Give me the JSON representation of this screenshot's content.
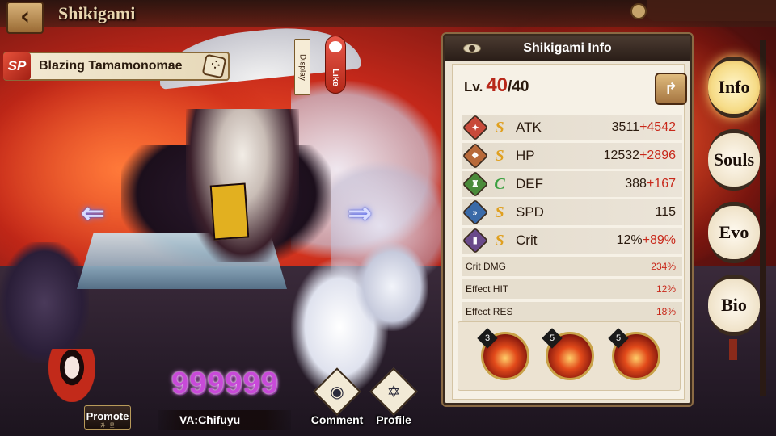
{
  "header": {
    "title": "Shikigami",
    "back_icon": "back-arrow-icon"
  },
  "character": {
    "rarity": "SP",
    "name": "Blazing Tamamonomae",
    "display_label": "Display",
    "like_label": "Like"
  },
  "bottom": {
    "promote_label": "Promote",
    "promote_sub": "升 · 星",
    "coins": "999999",
    "va": "VA:Chifuyu",
    "comment_label": "Comment",
    "profile_label": "Profile"
  },
  "info_panel": {
    "title": "Shikigami Info",
    "level_label": "Lv.",
    "level_current": "40",
    "level_max": "/40",
    "stats": [
      {
        "name": "ATK",
        "grade": "S",
        "base": "3511",
        "bonus": "+4542",
        "icon": "atk-icon",
        "color": "#c84a3a"
      },
      {
        "name": "HP",
        "grade": "S",
        "base": "12532",
        "bonus": "+2896",
        "icon": "hp-icon",
        "color": "#b86a3a"
      },
      {
        "name": "DEF",
        "grade": "C",
        "base": "388",
        "bonus": "+167",
        "icon": "def-icon",
        "color": "#4a8a3a"
      },
      {
        "name": "SPD",
        "grade": "S",
        "base": "115",
        "bonus": "",
        "icon": "spd-icon",
        "color": "#3a6aa8"
      },
      {
        "name": "Crit",
        "grade": "S",
        "base": "12%",
        "bonus": "+89%",
        "icon": "crit-icon",
        "color": "#6a4a8a"
      }
    ],
    "sub_stats": [
      {
        "name": "Crit DMG",
        "value": "234%"
      },
      {
        "name": "Effect HIT",
        "value": "12%"
      },
      {
        "name": "Effect RES",
        "value": "18%"
      }
    ],
    "skills": [
      {
        "level": "3"
      },
      {
        "level": "5"
      },
      {
        "level": "5"
      }
    ]
  },
  "side_tabs": [
    "Info",
    "Souls",
    "Evo",
    "Bio"
  ],
  "colors": {
    "accent_red": "#c8281a",
    "grade_S": "#e0a020",
    "grade_C": "#3aa040",
    "coin_purple": "#c84ad8"
  }
}
